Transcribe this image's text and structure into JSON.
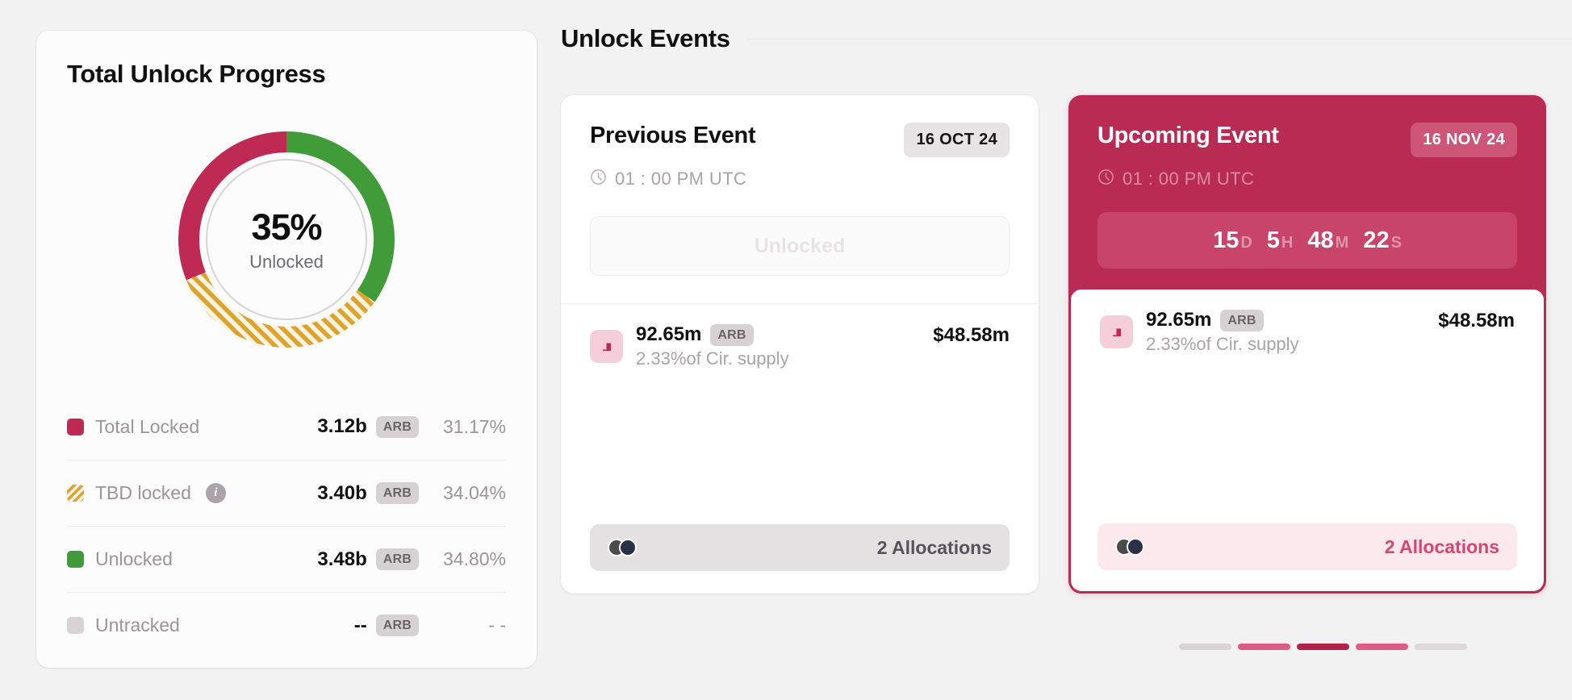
{
  "progress": {
    "title": "Total Unlock Progress",
    "donut": {
      "percent_label": "35%",
      "sub_label": "Unlocked"
    },
    "legend": [
      {
        "label": "Total Locked",
        "swatch": "solid-crimson",
        "color": "#bf2a55",
        "value": "3.12b",
        "unit": "ARB",
        "percent": "31.17%",
        "info": false
      },
      {
        "label": "TBD locked",
        "swatch": "striped-gold",
        "color": "#dda32c",
        "value": "3.40b",
        "unit": "ARB",
        "percent": "34.04%",
        "info": true,
        "info_glyph": "i"
      },
      {
        "label": "Unlocked",
        "swatch": "solid-green",
        "color": "#3f9c39",
        "value": "3.48b",
        "unit": "ARB",
        "percent": "34.80%",
        "info": false
      },
      {
        "label": "Untracked",
        "swatch": "solid-grey",
        "color": "#d8d4d5",
        "value": "--",
        "unit": "ARB",
        "percent": "- -",
        "info": false
      }
    ]
  },
  "events": {
    "title": "Unlock Events",
    "previous": {
      "name": "Previous Event",
      "date": "16 OCT 24",
      "time": "01 : 00 PM UTC",
      "clock_icon": "clock-icon",
      "status": "Unlocked",
      "allocation": {
        "token_icon": "arb-token-icon",
        "amount": "92.65m",
        "unit": "ARB",
        "supply_note": "2.33%of Cir. supply",
        "usd": "$48.58m"
      },
      "footer": {
        "avatars_icon": "avatar-stack-icon",
        "count_label": "2 Allocations"
      }
    },
    "upcoming": {
      "name": "Upcoming Event",
      "date": "16 NOV 24",
      "time": "01 : 00 PM UTC",
      "clock_icon": "clock-icon",
      "countdown": [
        {
          "value": "15",
          "unit": "D"
        },
        {
          "value": "5",
          "unit": "H"
        },
        {
          "value": "48",
          "unit": "M"
        },
        {
          "value": "22",
          "unit": "S"
        }
      ],
      "allocation": {
        "token_icon": "arb-token-icon",
        "amount": "92.65m",
        "unit": "ARB",
        "supply_note": "2.33%of Cir. supply",
        "usd": "$48.58m"
      },
      "footer": {
        "avatars_icon": "avatar-stack-icon",
        "count_label": "2 Allocations"
      }
    }
  },
  "pagination": {
    "bars": [
      {
        "state": "inactive",
        "color": "#d9d5d6"
      },
      {
        "state": "near",
        "color": "#df5b7f"
      },
      {
        "state": "active",
        "color": "#b52049"
      },
      {
        "state": "near",
        "color": "#df5b7f"
      },
      {
        "state": "inactive",
        "color": "#ddd9da"
      }
    ]
  },
  "chart_data": {
    "type": "pie",
    "title": "Total Unlock Progress",
    "center_label": "35%",
    "center_sublabel": "Unlocked",
    "categories": [
      "Unlocked",
      "TBD locked",
      "Total Locked",
      "Untracked"
    ],
    "values": [
      34.8,
      34.04,
      31.17,
      0
    ],
    "value_unit": "%",
    "absolute_values": [
      "3.48b",
      "3.40b",
      "3.12b",
      "--"
    ],
    "absolute_unit": "ARB",
    "colors": [
      "#3f9c39",
      "#dda32c",
      "#bf2a55",
      "#d8d4d5"
    ],
    "patterns": [
      "solid",
      "diagonal-stripes",
      "solid",
      "solid"
    ],
    "start_angle_deg": 0,
    "direction": "clockwise",
    "donut_hole_ratio": 0.76,
    "legend_position": "below"
  }
}
